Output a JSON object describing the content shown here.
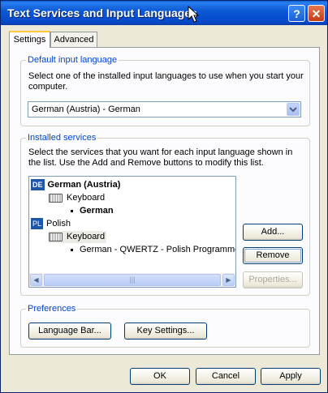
{
  "window": {
    "title": "Text Services and Input Languages",
    "help_button": "?",
    "close_button": "✕"
  },
  "tabs": [
    {
      "label": "Settings"
    },
    {
      "label": "Advanced"
    }
  ],
  "default_input": {
    "legend": "Default input language",
    "description": "Select one of the installed input languages to use when you start your computer.",
    "selected_value": "German (Austria) - German"
  },
  "installed_services": {
    "legend": "Installed services",
    "description": "Select the services that you want for each input language shown in the list. Use the Add and Remove buttons to modify this list.",
    "tree": {
      "lang1": {
        "badge": "DE",
        "label": "German (Austria)"
      },
      "lang1_category": "Keyboard",
      "lang1_layout": "German",
      "lang2": {
        "badge": "PL",
        "label": "Polish"
      },
      "lang2_category": "Keyboard",
      "lang2_layout": "German - QWERTZ - Polish Programmer"
    },
    "scroll_left": "◀",
    "scroll_thumb": "|||",
    "scroll_right": "▶",
    "add_label": "Add...",
    "remove_label": "Remove",
    "properties_label": "Properties..."
  },
  "preferences": {
    "legend": "Preferences",
    "language_bar_label": "Language Bar...",
    "key_settings_label": "Key Settings..."
  },
  "footer": {
    "ok_label": "OK",
    "cancel_label": "Cancel",
    "apply_label": "Apply"
  }
}
